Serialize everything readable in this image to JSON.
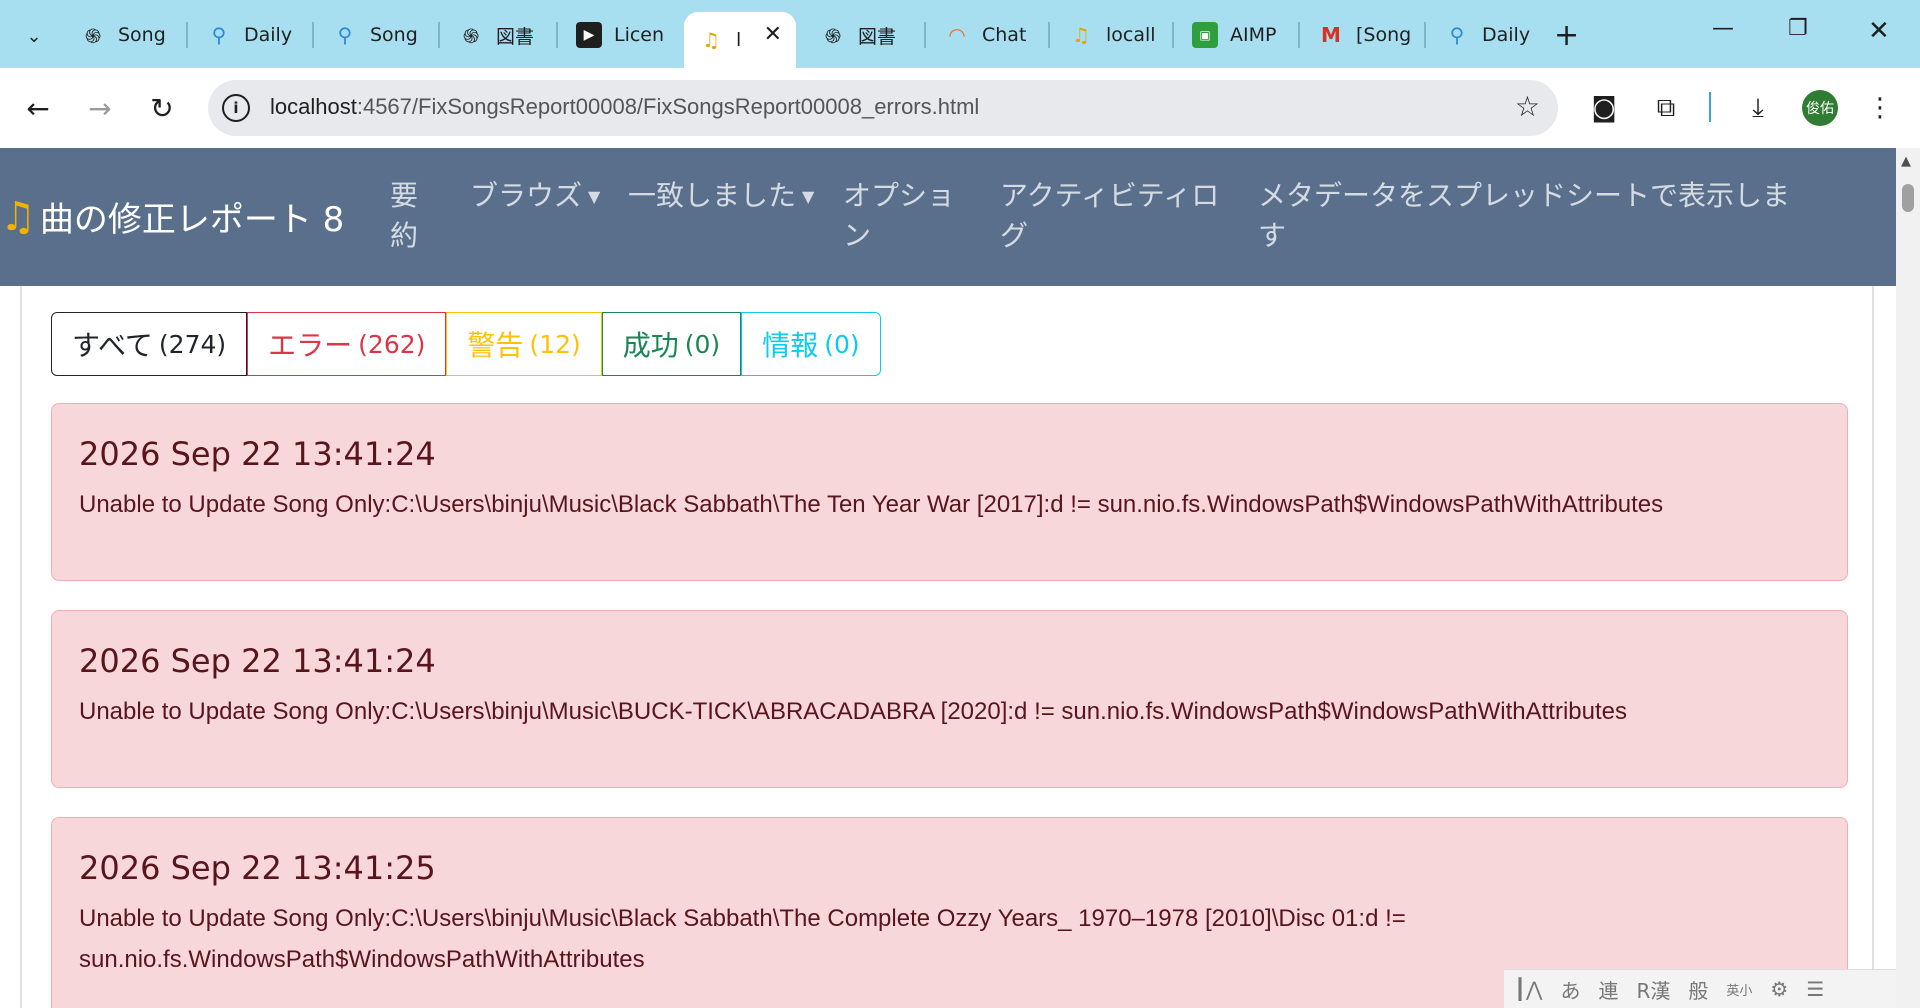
{
  "browser": {
    "tabs": [
      {
        "title": "Song",
        "icon": "openai-icon"
      },
      {
        "title": "Daily",
        "icon": "pin-icon"
      },
      {
        "title": "Song",
        "icon": "pin-icon"
      },
      {
        "title": "図書",
        "icon": "openai-icon"
      },
      {
        "title": "Licen",
        "icon": "play-icon"
      },
      {
        "title": "l",
        "icon": "music-note-icon",
        "active": true
      },
      {
        "title": "図書",
        "icon": "openai-icon"
      },
      {
        "title": "Chat",
        "icon": "rainbow-icon"
      },
      {
        "title": "locall",
        "icon": "music-note-icon"
      },
      {
        "title": "AIMP",
        "icon": "aimp-icon"
      },
      {
        "title": "[Song",
        "icon": "gmail-icon"
      },
      {
        "title": "Daily",
        "icon": "pin-icon"
      }
    ],
    "url_host": "localhost",
    "url_path": ":4567/FixSongsReport00008/FixSongsReport00008_errors.html",
    "profile_initials": "俊佑"
  },
  "app": {
    "brand": "曲の修正レポート 8",
    "nav": [
      {
        "label": "要\n約"
      },
      {
        "label": "ブラウズ",
        "dropdown": true
      },
      {
        "label": "一致しました",
        "dropdown": true
      },
      {
        "label": "オプショ\nン"
      },
      {
        "label": "アクティビティロ\nグ"
      },
      {
        "label": "メタデータをスプレッドシートで表示しま\nす"
      }
    ]
  },
  "filters": [
    {
      "label": "すべて",
      "count": "(274)",
      "color": "#212529"
    },
    {
      "label": "エラー",
      "count": "(262)",
      "color": "#dc3545"
    },
    {
      "label": "警告",
      "count": "(12)",
      "color": "#ffc107"
    },
    {
      "label": "成功",
      "count": "(0)",
      "color": "#198754"
    },
    {
      "label": "情報",
      "count": "(0)",
      "color": "#0dcaf0"
    }
  ],
  "entries": [
    {
      "timestamp": "2026 Sep 22 13:41:24",
      "message": "Unable to Update Song Only:C:\\Users\\binju\\Music\\Black Sabbath\\The Ten Year War [2017]:d != sun.nio.fs.WindowsPath$WindowsPathWithAttributes"
    },
    {
      "timestamp": "2026 Sep 22 13:41:24",
      "message": "Unable to Update Song Only:C:\\Users\\binju\\Music\\BUCK‐TICK\\ABRACADABRA [2020]:d != sun.nio.fs.WindowsPath$WindowsPathWithAttributes"
    },
    {
      "timestamp": "2026 Sep 22 13:41:25",
      "message": "Unable to Update Song Only:C:\\Users\\binju\\Music\\Black Sabbath\\The Complete Ozzy Years_ 1970–1978 [2010]\\Disc 01:d != sun.nio.fs.WindowsPath$WindowsPathWithAttributes"
    }
  ],
  "ime": [
    "あ",
    "連",
    "R漢",
    "般",
    "英小"
  ]
}
